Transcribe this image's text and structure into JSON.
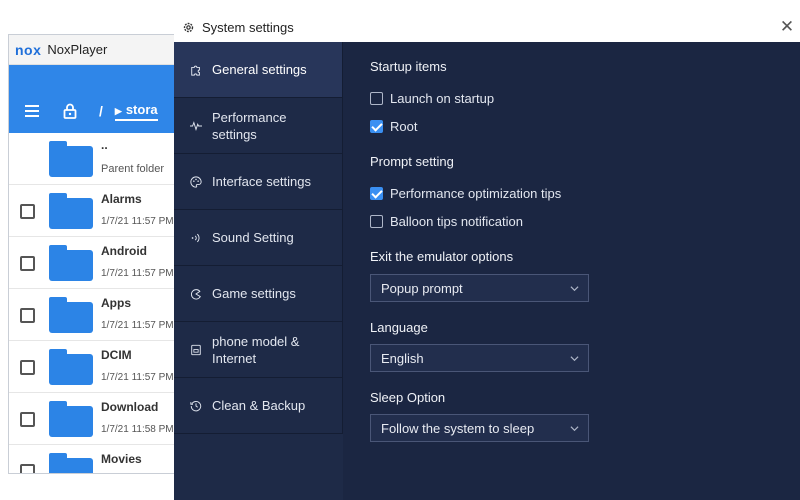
{
  "nox": {
    "logo": "nox",
    "title": "NoxPlayer",
    "path_root": "/",
    "path_crumb": "stora",
    "files": [
      {
        "name": "..",
        "date": "Parent folder",
        "parent": true
      },
      {
        "name": "Alarms",
        "date": "1/7/21 11:57 PM"
      },
      {
        "name": "Android",
        "date": "1/7/21 11:57 PM"
      },
      {
        "name": "Apps",
        "date": "1/7/21 11:57 PM"
      },
      {
        "name": "DCIM",
        "date": "1/7/21 11:57 PM"
      },
      {
        "name": "Download",
        "date": "1/7/21 11:58 PM"
      },
      {
        "name": "Movies",
        "date": ""
      }
    ]
  },
  "settings": {
    "title": "System settings",
    "close": "✕",
    "nav": [
      {
        "label": "General settings",
        "icon": "puzzle-icon",
        "active": true
      },
      {
        "label": "Performance settings",
        "icon": "pulse-icon",
        "active": false
      },
      {
        "label": "Interface settings",
        "icon": "palette-icon",
        "active": false
      },
      {
        "label": "Sound Setting",
        "icon": "sound-icon",
        "active": false
      },
      {
        "label": "Game settings",
        "icon": "game-icon",
        "active": false
      },
      {
        "label": "phone model & Internet",
        "icon": "phone-icon",
        "active": false
      },
      {
        "label": "Clean & Backup",
        "icon": "clock-icon",
        "active": false
      }
    ],
    "startup": {
      "title": "Startup items",
      "launch_on_startup": {
        "label": "Launch on startup",
        "checked": false
      },
      "root": {
        "label": "Root",
        "checked": true
      }
    },
    "prompt": {
      "title": "Prompt setting",
      "performance_tips": {
        "label": "Performance optimization tips",
        "checked": true
      },
      "balloon_tips": {
        "label": "Balloon tips notification",
        "checked": false
      }
    },
    "exit": {
      "title": "Exit the emulator options",
      "value": "Popup prompt"
    },
    "language": {
      "title": "Language",
      "value": "English"
    },
    "sleep": {
      "title": "Sleep Option",
      "value": "Follow the system to sleep"
    }
  },
  "colors": {
    "panel_bg": "#1e2a47",
    "accent": "#3a8ff2",
    "nox_blue": "#2f86e8"
  }
}
